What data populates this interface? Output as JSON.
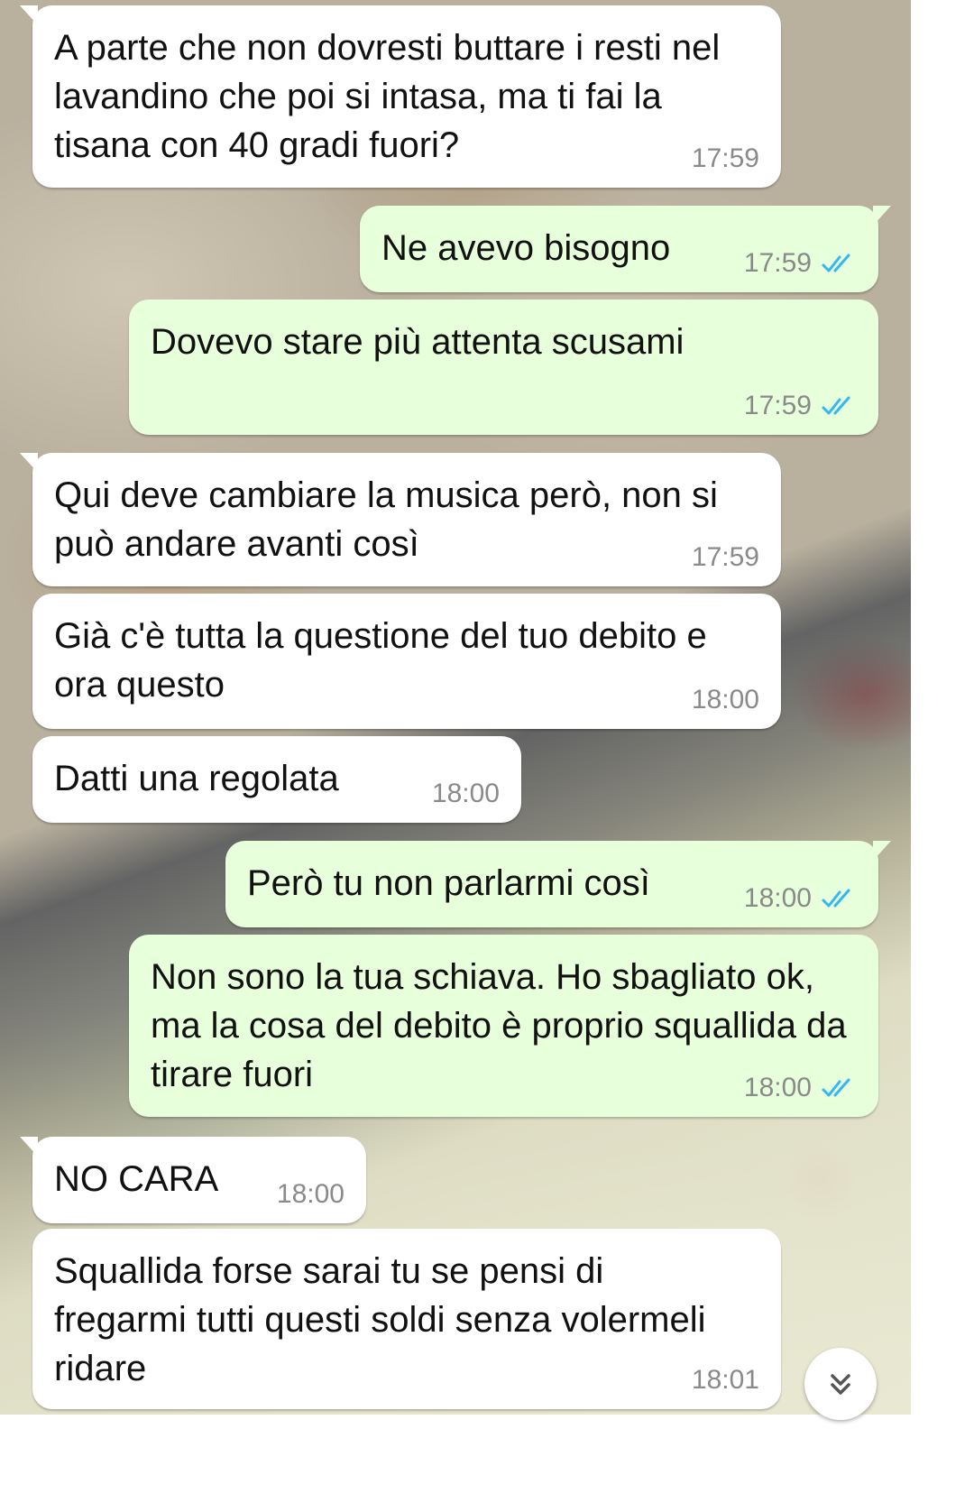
{
  "colors": {
    "incoming_bubble": "#ffffff",
    "outgoing_bubble": "#e7ffdb",
    "timestamp": "#8a8a8a",
    "read_receipt": "#34b7f1"
  },
  "messages": [
    {
      "direction": "in",
      "text": "A parte che non dovresti buttare i resti nel lavandino che poi si intasa, ma ti fai la tisana con 40 gradi fuori?",
      "time": "17:59"
    },
    {
      "direction": "out",
      "text": "Ne avevo bisogno",
      "time": "17:59",
      "status": "read"
    },
    {
      "direction": "out",
      "text": "Dovevo stare più attenta scusami",
      "time": "17:59",
      "status": "read"
    },
    {
      "direction": "in",
      "text": "Qui deve cambiare la musica però, non si può andare avanti così",
      "time": "17:59"
    },
    {
      "direction": "in",
      "text": "Già c'è tutta la questione del tuo debito e ora questo",
      "time": "18:00"
    },
    {
      "direction": "in",
      "text": "Datti una regolata",
      "time": "18:00"
    },
    {
      "direction": "out",
      "text": "Però tu non parlarmi così",
      "time": "18:00",
      "status": "read"
    },
    {
      "direction": "out",
      "text": "Non sono la tua schiava. Ho sbagliato ok, ma la cosa del debito è proprio squallida da tirare fuori",
      "time": "18:00",
      "status": "read"
    },
    {
      "direction": "in",
      "text": "NO CARA",
      "time": "18:00"
    },
    {
      "direction": "in",
      "text": "Squallida forse sarai tu se pensi di fregarmi tutti questi soldi senza volermeli ridare",
      "time": "18:01"
    }
  ],
  "scroll_button": {
    "icon": "double-chevron-down-icon"
  }
}
